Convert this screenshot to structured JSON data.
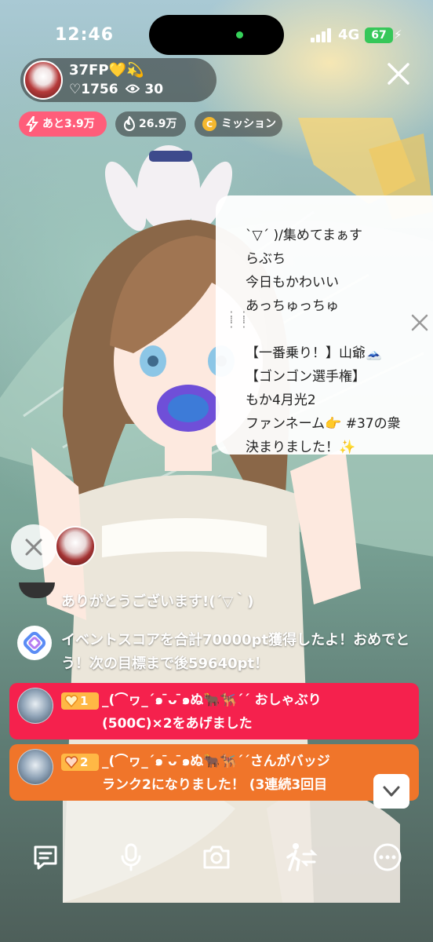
{
  "status_bar": {
    "time": "12:46",
    "network": "4G",
    "battery": "67"
  },
  "streamer": {
    "name": "37FP💛💫",
    "hearts": "♡1756",
    "viewers": "30",
    "avatar_icon": "avatar-image"
  },
  "chips": {
    "remaining": "あと3.9万",
    "fire_points": "26.9万",
    "mission": "ミッション"
  },
  "profile_card": {
    "text": "ˋ▽ˊ )/集めてまぁす\nらぶち\n今日もかわいい\nあっちゅっちゅ\n\n【一番乗り！】山爺🗻\n【ゴンゴン選手権】\nもか4月光2\nファンネーム👉 #37の衆\n決まりました！✨"
  },
  "chat": {
    "thanks": "ありがとうございます!(´▽｀)",
    "system_message": "イベントスコアを合計70000pt獲得したよ！おめでとう！次の目標まで後59640pt！",
    "gift": {
      "rank": "1",
      "line1": "_(⌒ヮ_´๑ ̄ᴗ ̄๑ぬ🐂🐕‍🦺ˊˊ おしゃぶり",
      "line2": "(500C)×2をあげました"
    },
    "badge": {
      "rank": "2",
      "line1": "_(⌒ヮ_´๑ ̄ᴗ ̄๑ぬ🐂🐕‍🦺ˊˊさんがバッジ",
      "line2": "ランク2になりました！ (3連続3回目"
    }
  },
  "toolbar": {
    "icons": [
      "comment-icon",
      "microphone-icon",
      "camera-icon",
      "collab-icon",
      "more-icon"
    ]
  },
  "colors": {
    "gift_bubble": "#f5214d",
    "badge_bubble": "#f0752a",
    "remaining_chip": "#ff5d7a",
    "rank_badge": "#ffb845",
    "battery": "#36c759"
  }
}
